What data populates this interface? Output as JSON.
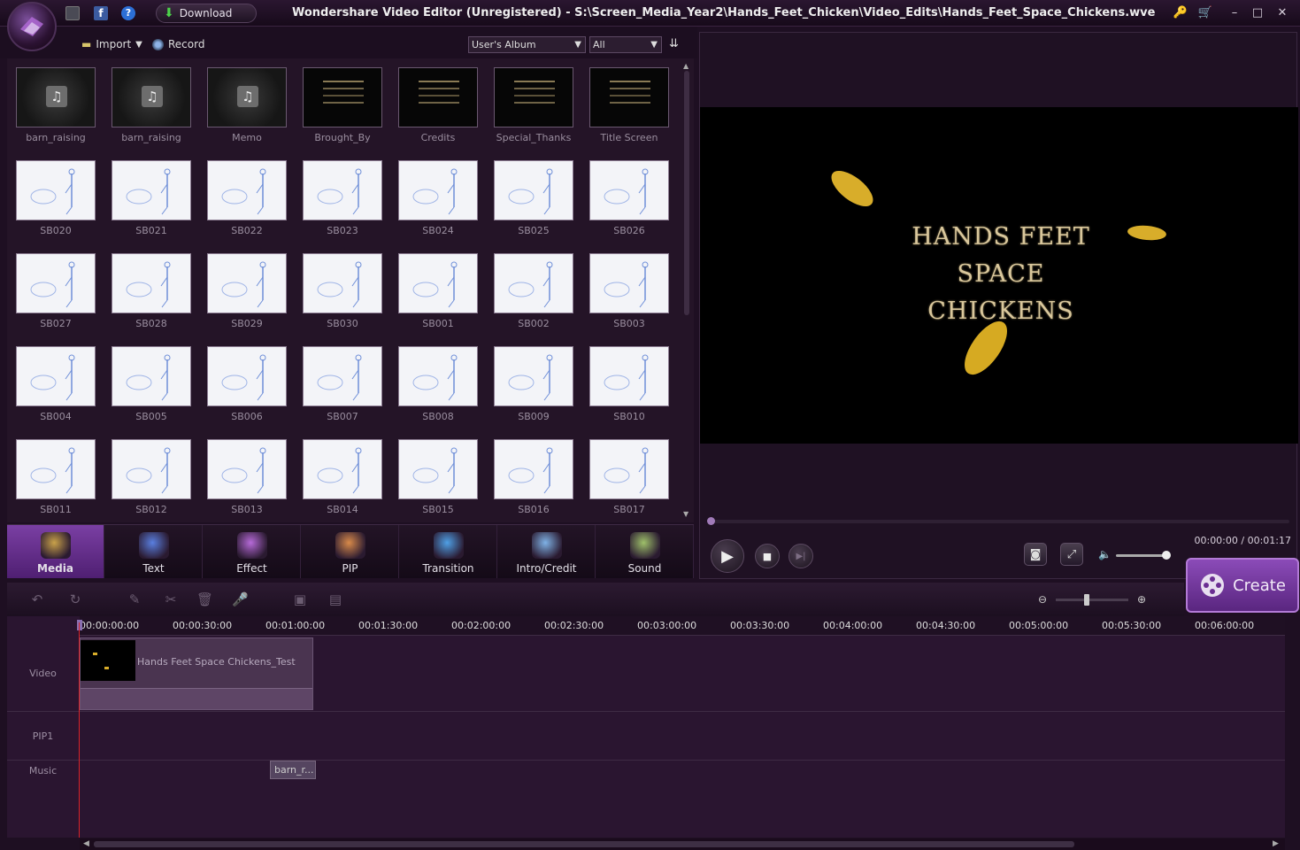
{
  "window": {
    "title": "Wondershare Video Editor (Unregistered) - S:\\Screen_Media_Year2\\Hands_Feet_Chicken\\Video_Edits\\Hands_Feet_Space_Chickens.wve",
    "download_label": "Download",
    "controls": [
      "🔑",
      "🛒",
      "–",
      "□",
      "✕"
    ]
  },
  "media_toolbar": {
    "import_label": "Import",
    "record_label": "Record",
    "album_select": "User's Album",
    "filter_select": "All"
  },
  "media_items": [
    {
      "label": "barn_raising",
      "kind": "audio"
    },
    {
      "label": "barn_raising",
      "kind": "audio"
    },
    {
      "label": "Memo",
      "kind": "audio"
    },
    {
      "label": "Brought_By",
      "kind": "black"
    },
    {
      "label": "Credits",
      "kind": "black"
    },
    {
      "label": "Special_Thanks",
      "kind": "black"
    },
    {
      "label": "Title Screen",
      "kind": "black"
    },
    {
      "label": "SB020",
      "kind": "sketch"
    },
    {
      "label": "SB021",
      "kind": "sketch"
    },
    {
      "label": "SB022",
      "kind": "sketch"
    },
    {
      "label": "SB023",
      "kind": "sketch"
    },
    {
      "label": "SB024",
      "kind": "sketch"
    },
    {
      "label": "SB025",
      "kind": "sketch"
    },
    {
      "label": "SB026",
      "kind": "sketch"
    },
    {
      "label": "SB027",
      "kind": "sketch"
    },
    {
      "label": "SB028",
      "kind": "sketch"
    },
    {
      "label": "SB029",
      "kind": "sketch"
    },
    {
      "label": "SB030",
      "kind": "sketch"
    },
    {
      "label": "SB001",
      "kind": "sketch"
    },
    {
      "label": "SB002",
      "kind": "sketch"
    },
    {
      "label": "SB003",
      "kind": "sketch"
    },
    {
      "label": "SB004",
      "kind": "sketch"
    },
    {
      "label": "SB005",
      "kind": "sketch"
    },
    {
      "label": "SB006",
      "kind": "sketch"
    },
    {
      "label": "SB007",
      "kind": "sketch"
    },
    {
      "label": "SB008",
      "kind": "sketch"
    },
    {
      "label": "SB009",
      "kind": "sketch"
    },
    {
      "label": "SB010",
      "kind": "sketch"
    },
    {
      "label": "SB011",
      "kind": "sketch"
    },
    {
      "label": "SB012",
      "kind": "sketch"
    },
    {
      "label": "SB013",
      "kind": "sketch"
    },
    {
      "label": "SB014",
      "kind": "sketch"
    },
    {
      "label": "SB015",
      "kind": "sketch"
    },
    {
      "label": "SB016",
      "kind": "sketch"
    },
    {
      "label": "SB017",
      "kind": "sketch"
    }
  ],
  "categories": [
    {
      "label": "Media",
      "icon": "media-icon",
      "active": true
    },
    {
      "label": "Text",
      "icon": "text-icon"
    },
    {
      "label": "Effect",
      "icon": "effect-icon"
    },
    {
      "label": "PIP",
      "icon": "pip-icon"
    },
    {
      "label": "Transition",
      "icon": "transition-icon"
    },
    {
      "label": "Intro/Credit",
      "icon": "intro-credit-icon"
    },
    {
      "label": "Sound",
      "icon": "sound-icon"
    }
  ],
  "preview": {
    "screen_title_line1": "HANDS FEET",
    "screen_title_line2": "SPACE CHICKENS",
    "timecode": "00:00:00 / 00:01:17",
    "progress": 0.0,
    "volume": 0.9
  },
  "create_label": "Create",
  "timeline": {
    "ruler_labels": [
      "00:00:00:00",
      "00:00:30:00",
      "00:01:00:00",
      "00:01:30:00",
      "00:02:00:00",
      "00:02:30:00",
      "00:03:00:00",
      "00:03:30:00",
      "00:04:00:00",
      "00:04:30:00",
      "00:05:00:00",
      "00:05:30:00",
      "00:06:00:00"
    ],
    "tracks": {
      "video": "Video",
      "pip": "PIP1",
      "music": "Music"
    },
    "video_clip": "Hands Feet Space Chickens_Test",
    "music_clip": "barn_r..."
  },
  "colors": {
    "accent": "#7a3fa3",
    "playhead": "#d8232a",
    "background": "#1e0f22"
  }
}
